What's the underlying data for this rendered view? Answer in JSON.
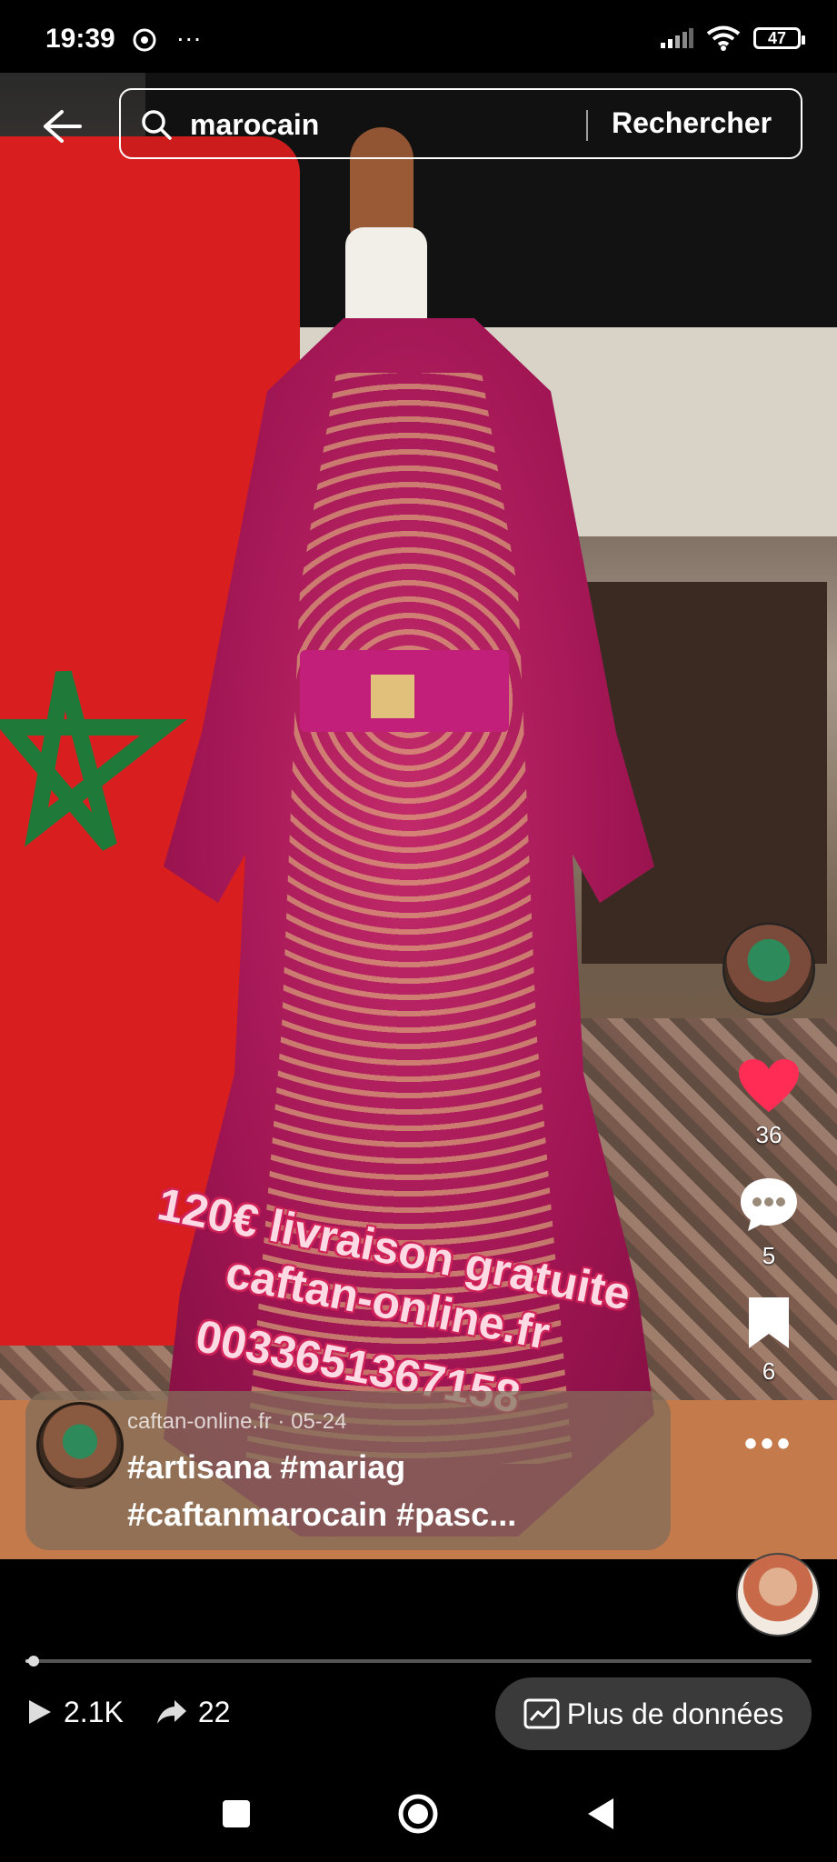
{
  "status_bar": {
    "time": "19:39",
    "left_icons": [
      "chrome-icon",
      "more-dots-icon"
    ],
    "more_glyph": "···",
    "battery": "47"
  },
  "search": {
    "value": "marocain",
    "button_label": "Rechercher"
  },
  "video": {
    "overlay_lines": [
      "120€ livraison gratuite",
      "caftan-online.fr",
      "0033651367158"
    ]
  },
  "side_actions": {
    "likes": "36",
    "comments": "5",
    "saves": "6",
    "more_glyph": "•••"
  },
  "caption": {
    "author": "caftan-online.fr",
    "separator": " · ",
    "date": "05-24",
    "tags_line1": "#artisana #mariag",
    "tags_line2": "#caftanmarocain #pasc..."
  },
  "progress": {
    "fraction": 0.01
  },
  "stats": {
    "views": "2.1K",
    "shares": "22",
    "more_data_label": "Plus de données"
  },
  "colors": {
    "like_heart": "#ff2d55",
    "overlay_text": "#ffd9e3",
    "overlay_glow": "#d0245a"
  }
}
